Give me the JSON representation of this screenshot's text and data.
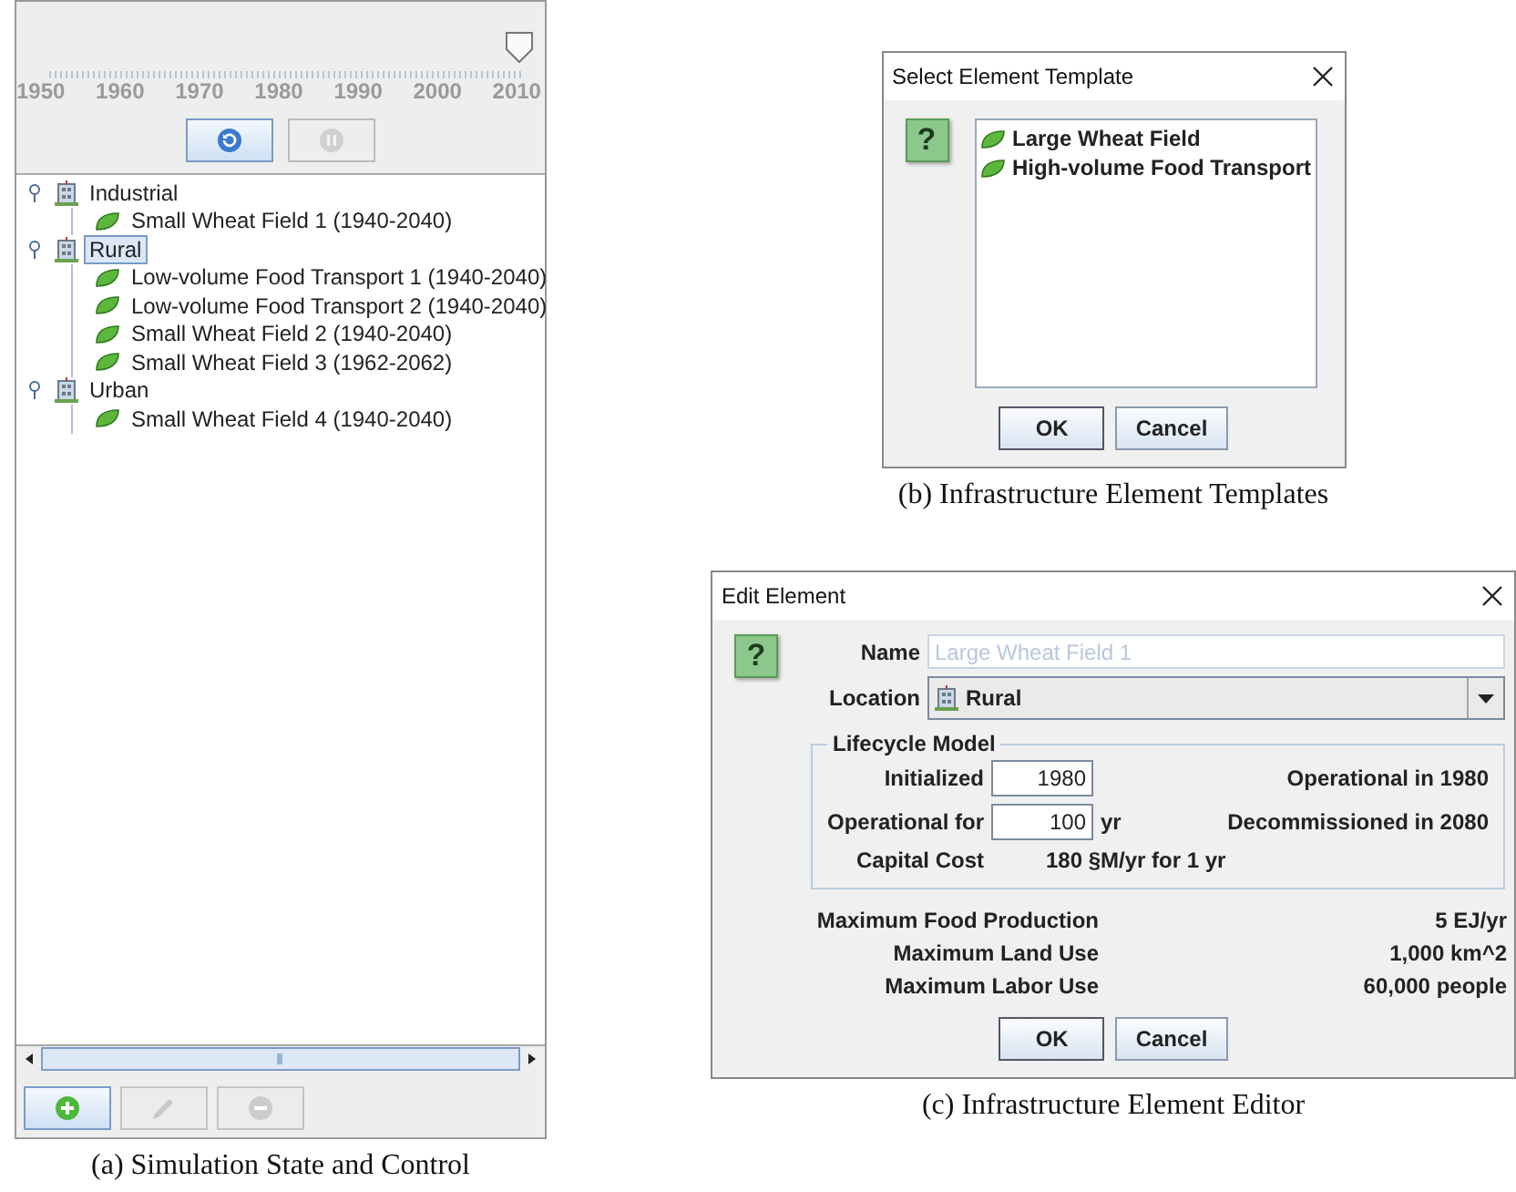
{
  "simulation": {
    "timeline": {
      "labels": [
        "1950",
        "1960",
        "1970",
        "1980",
        "1990",
        "2000",
        "2010"
      ],
      "level": 1
    },
    "controls": [
      {
        "kind": "replay",
        "disabled": false
      },
      {
        "kind": "pause",
        "disabled": true
      }
    ],
    "tree": [
      {
        "label": "Industrial",
        "expanded": true,
        "selected": false,
        "children": [
          {
            "label": "Small Wheat Field 1 (1940-2040)",
            "selected": false
          }
        ]
      },
      {
        "label": "Rural",
        "expanded": true,
        "selected": true,
        "children": [
          {
            "label": "Low-volume Food Transport 1 (1940-2040)",
            "selected": false
          },
          {
            "label": "Low-volume Food Transport 2 (1940-2040)",
            "selected": false
          },
          {
            "label": "Small Wheat Field 2 (1940-2040)",
            "selected": false
          },
          {
            "label": "Small Wheat Field 3 (1962-2062)",
            "selected": false
          }
        ]
      },
      {
        "label": "Urban",
        "expanded": true,
        "selected": false,
        "children": [
          {
            "label": "Small Wheat Field 4 (1940-2040)",
            "selected": false
          }
        ]
      }
    ],
    "actions": [
      {
        "kind": "add",
        "disabled": false
      },
      {
        "kind": "edit",
        "disabled": true
      },
      {
        "kind": "remove",
        "disabled": true
      }
    ],
    "caption": "(a) Simulation State and Control"
  },
  "template_dialog": {
    "title": "Select Element Template",
    "help": "?",
    "items": [
      {
        "label": "Large Wheat Field",
        "selected": false
      },
      {
        "label": "High-volume Food Transport",
        "selected": false
      }
    ],
    "buttons": [
      "OK",
      "Cancel"
    ],
    "caption": "(b) Infrastructure Element Templates"
  },
  "edit_dialog": {
    "title": "Edit Element",
    "help": "?",
    "name": {
      "label": "Name",
      "placeholder": "Large Wheat Field 1"
    },
    "location": {
      "label": "Location",
      "value": "Rural"
    },
    "lifecycle": {
      "title": "Lifecycle Model",
      "rows": [
        {
          "label": "Initialized",
          "value": "1980",
          "unit": "",
          "status": "Operational in 1980"
        },
        {
          "label": "Operational for",
          "value": "100",
          "unit": "yr",
          "status": "Decommissioned in 2080"
        }
      ],
      "cost": {
        "label": "Capital Cost",
        "value": "180 §M/yr for 1 yr"
      }
    },
    "specs": [
      {
        "label": "Maximum Food Production",
        "value": "5 EJ/yr"
      },
      {
        "label": "Maximum Land Use",
        "value": "1,000 km^2"
      },
      {
        "label": "Maximum Labor Use",
        "value": "60,000 people"
      }
    ],
    "buttons": [
      "OK",
      "Cancel"
    ],
    "caption": "(c) Infrastructure Element Editor"
  }
}
